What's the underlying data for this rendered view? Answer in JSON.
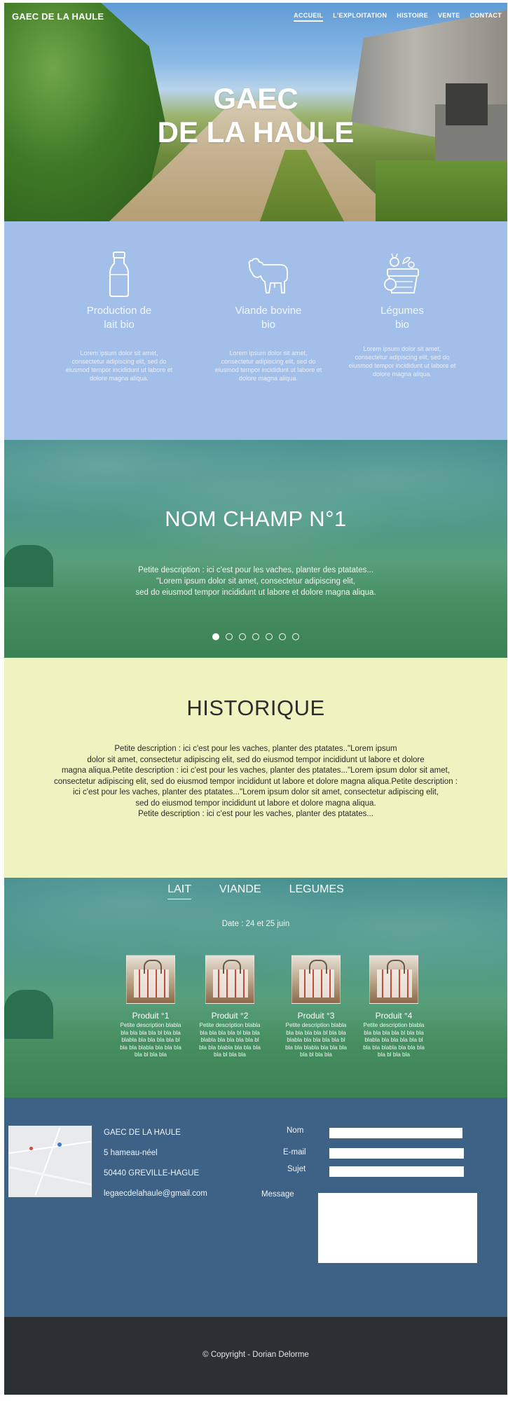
{
  "header": {
    "brand": "GAEC DE LA HAULE",
    "nav": [
      "ACCUEIL",
      "L'EXPLOITATION",
      "HISTOIRE",
      "VENTE",
      "CONTACT"
    ],
    "active_nav": "ACCUEIL"
  },
  "hero": {
    "title_line1": "GAEC",
    "title_line2": "DE LA HAULE"
  },
  "services": [
    {
      "icon": "milk-bottle-icon",
      "title_line1": "Production de",
      "title_line2": "lait bio",
      "text": "Lorem ipsum dolor sit amet, consectetur adipiscing elit, sed do eiusmod tempor incididunt ut labore et dolore magna aliqua."
    },
    {
      "icon": "cow-icon",
      "title_line1": "Viande bovine",
      "title_line2": "bio",
      "text": "Lorem ipsum dolor sit amet, consectetur adipiscing elit, sed do eiusmod tempor incididunt ut labore et dolore magna aliqua."
    },
    {
      "icon": "vegetable-basket-icon",
      "title_line1": "Légumes",
      "title_line2": "bio",
      "text": "Lorem ipsum dolor sit amet, consectetur adipiscing elit, sed do eiusmod tempor incididunt ut labore et dolore magna aliqua."
    }
  ],
  "field_slider": {
    "title": "NOM CHAMP N°1",
    "desc_line1": "Petite description : ici c'est pour les vaches, planter des ptatates...",
    "desc_line2": "\"Lorem ipsum dolor sit amet, consectetur adipiscing elit,",
    "desc_line3": "sed do eiusmod tempor incididunt ut labore et dolore magna aliqua.",
    "dot_count": 7,
    "active_dot": 0
  },
  "historique": {
    "title": "HISTORIQUE",
    "lines": [
      "Petite description : ici c'est pour les vaches, planter des ptatates..\"Lorem ipsum",
      "dolor sit amet, consectetur adipiscing elit, sed do eiusmod tempor incididunt ut labore et dolore",
      "magna aliqua.Petite description : ici c'est pour les vaches, planter des ptatates...\"Lorem ipsum dolor sit amet,",
      "consectetur adipiscing elit, sed do eiusmod tempor incididunt ut labore et dolore magna aliqua.Petite description :",
      "ici c'est pour les vaches, planter des ptatates...\"Lorem ipsum dolor sit amet, consectetur adipiscing elit,",
      "sed do eiusmod tempor incididunt ut labore et dolore magna aliqua.",
      "Petite description : ici c'est pour les vaches, planter des ptatates..."
    ]
  },
  "products": {
    "tabs": [
      "LAIT",
      "VIANDE",
      "LEGUMES"
    ],
    "active_tab": "LAIT",
    "date": "Date : 24 et 25 juin",
    "items": [
      {
        "name": "Produit °1",
        "desc": "Petite description blabla bla bla bla bla bl bla bla blabla bla bla bla bla bl bla bla blabla bla bla bla bla bl bla bla"
      },
      {
        "name": "Produit °2",
        "desc": "Petite description blabla bla bla bla bla bl bla bla blabla bla bla bla bla bl bla bla blabla bla bla bla bla bl bla bla"
      },
      {
        "name": "Produit °3",
        "desc": "Petite description blabla bla bla bla bla bl bla bla blabla bla bla bla bla bl bla bla blabla bla bla bla bla bl bla bla"
      },
      {
        "name": "Produit °4",
        "desc": "Petite description blabla bla bla bla bla bl bla bla blabla bla bla bla bla bl bla bla blabla bla bla bla bla bl bla bla"
      }
    ]
  },
  "contact": {
    "name": "GAEC DE LA HAULE",
    "street": "5 hameau-néel",
    "city": "50440 GREVILLE-HAGUE",
    "email": "legaecdelahaule@gmail.com",
    "form": {
      "nom_label": "Nom",
      "email_label": "E-mail",
      "sujet_label": "Sujet",
      "message_label": "Message",
      "nom_value": "",
      "email_value": "",
      "sujet_value": "",
      "message_value": ""
    }
  },
  "footer": {
    "copyright": "© Copyright - Dorian Delorme"
  }
}
